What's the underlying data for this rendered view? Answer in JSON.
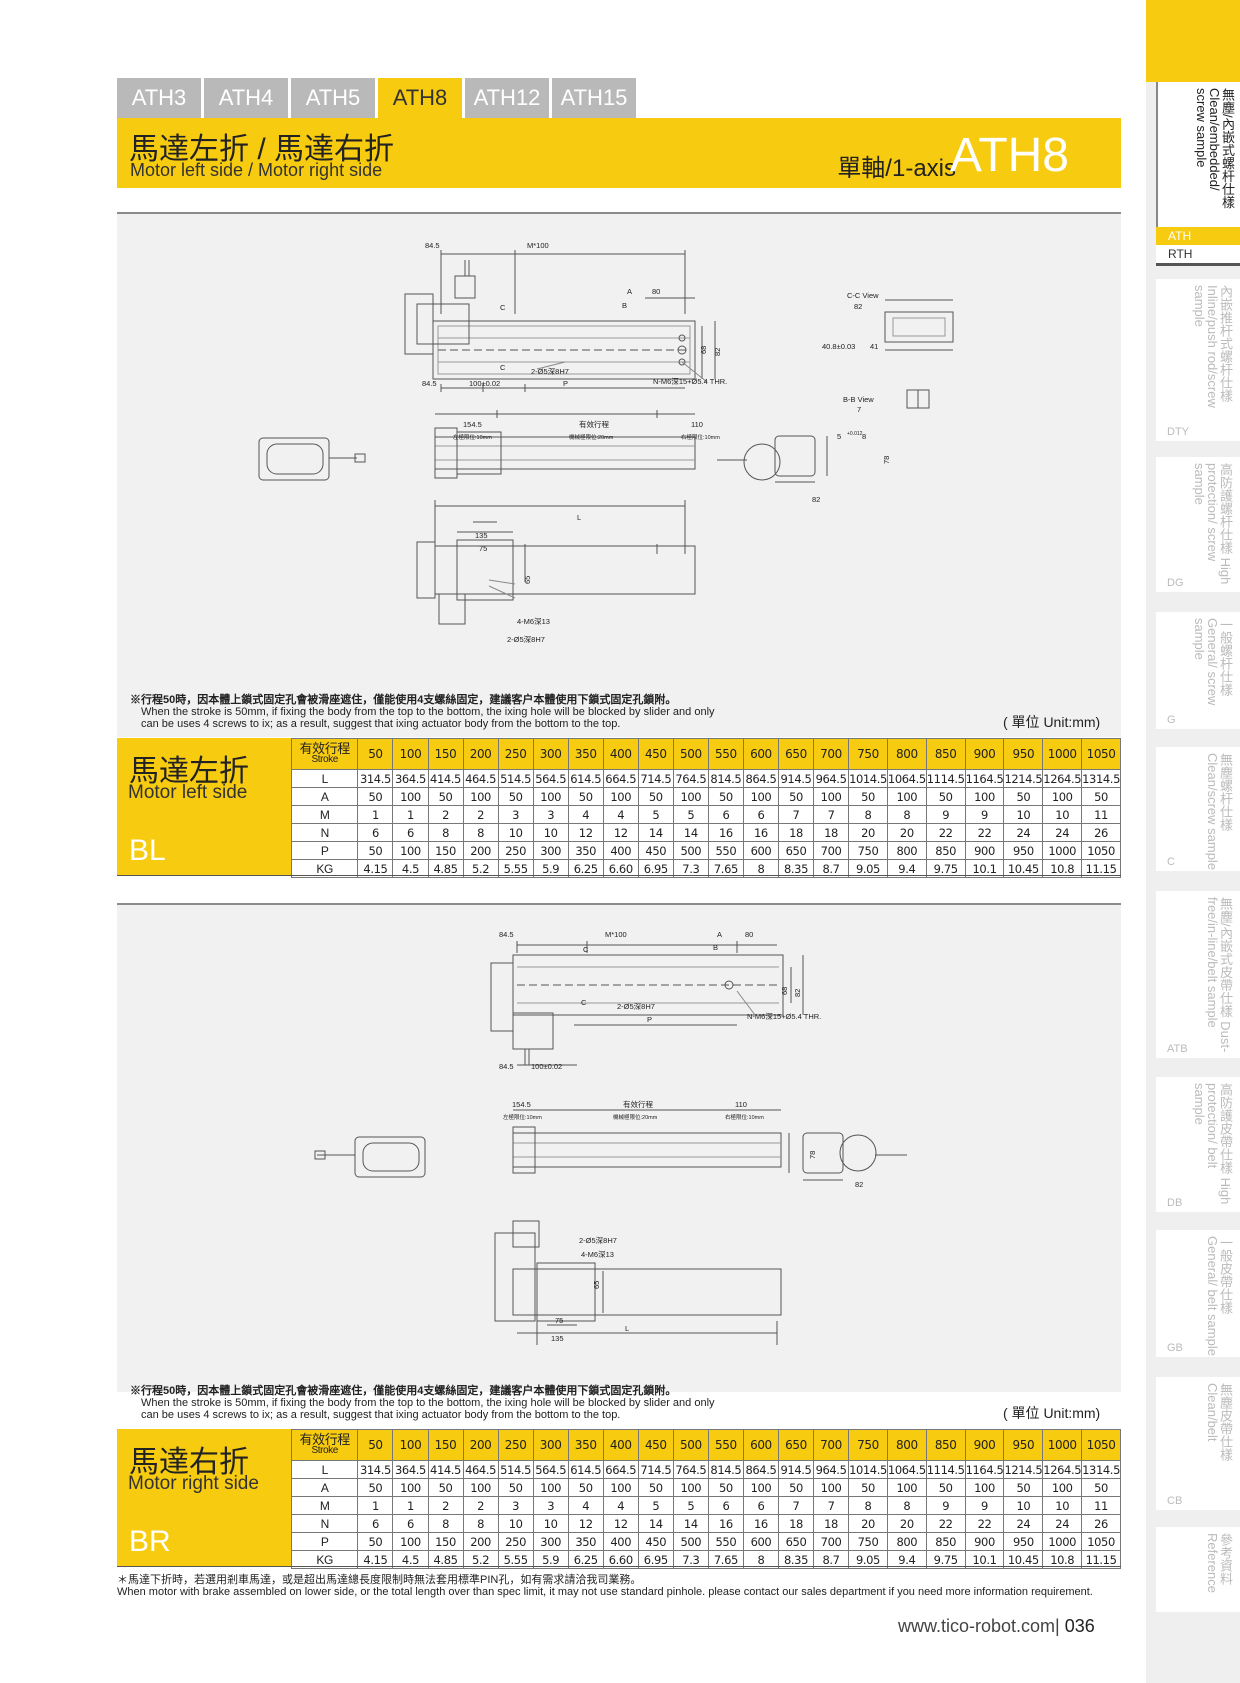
{
  "tabs": [
    "ATH3",
    "ATH4",
    "ATH5",
    "ATH8",
    "ATH12",
    "ATH15"
  ],
  "active_tab": "ATH8",
  "title": {
    "cn": "馬達左折 / 馬達右折",
    "en": "Motor left side / Motor right side",
    "axis": "單軸/1-axis",
    "model": "ATH8"
  },
  "drawing1": {
    "dims": {
      "d84_5": "84.5",
      "m100": "M*100",
      "a": "A",
      "b": "B",
      "c": "C",
      "d80": "80",
      "d68": "68",
      "d82": "82",
      "hole_c": "2-Ø5深8H7",
      "thread": "N-M6深15+Ø5.4 THR.",
      "d100": "100±0.02",
      "p": "P",
      "cc_view": "C-C View",
      "cc_82": "82",
      "cc_408": "40.8±0.03",
      "cc_41": "41",
      "bb_view": "B-B View",
      "bb_7": "7",
      "bb_5": "5",
      "bb_8": "8",
      "bb_tol": "+0.012",
      "d154_5": "154.5",
      "stroke": "有效行程",
      "d110": "110",
      "left_stop": "左極限位:10mm",
      "mid_stop": "機械極限位:20mm",
      "right_stop": "右極限位:10mm",
      "d78": "78",
      "end_82": "82",
      "l": "L",
      "d135": "135",
      "d75": "75",
      "d65": "65",
      "m6": "4-M6深13",
      "h7": "2-Ø5深8H7"
    }
  },
  "drawing2": {
    "dims": {
      "d84_5": "84.5",
      "m100": "M*100",
      "a": "A",
      "b": "B",
      "c": "C",
      "d80": "80",
      "d68": "68",
      "d82": "82",
      "hole_c": "2-Ø5深8H7",
      "thread": "N-M6深15+Ø5.4 THR.",
      "d100": "100±0.02",
      "p": "P",
      "d154_5": "154.5",
      "stroke": "有效行程",
      "d110": "110",
      "left_stop": "左極限位:10mm",
      "mid_stop": "機械極限位:20mm",
      "right_stop": "右極限位:10mm",
      "d78": "78",
      "end_82": "82",
      "l": "L",
      "d135": "135",
      "d75": "75",
      "d65": "65",
      "m6": "4-M6深13",
      "h7": "2-Ø5深8H7"
    }
  },
  "note": {
    "cn": "※行程50時，因本體上鎖式固定孔會被滑座遮住，僅能使用4支螺絲固定，建議客户本體使用下鎖式固定孔鎖附。",
    "en1": "When the stroke is 50mm, if fixing the body from the top to the bottom, the ixing hole will be blocked by slider and only",
    "en2": "can be uses 4 screws to ix; as a result, suggest that ixing actuator body from the bottom to the top.",
    "unit": "( 單位 Unit:mm)"
  },
  "table_header": {
    "cn": "有效行程",
    "en": "Stroke"
  },
  "strokes": [
    "50",
    "100",
    "150",
    "200",
    "250",
    "300",
    "350",
    "400",
    "450",
    "500",
    "550",
    "600",
    "650",
    "700",
    "750",
    "800",
    "850",
    "900",
    "950",
    "1000",
    "1050"
  ],
  "rows": [
    {
      "label": "L",
      "values": [
        "314.5",
        "364.5",
        "414.5",
        "464.5",
        "514.5",
        "564.5",
        "614.5",
        "664.5",
        "714.5",
        "764.5",
        "814.5",
        "864.5",
        "914.5",
        "964.5",
        "1014.5",
        "1064.5",
        "1114.5",
        "1164.5",
        "1214.5",
        "1264.5",
        "1314.5"
      ]
    },
    {
      "label": "A",
      "values": [
        "50",
        "100",
        "50",
        "100",
        "50",
        "100",
        "50",
        "100",
        "50",
        "100",
        "50",
        "100",
        "50",
        "100",
        "50",
        "100",
        "50",
        "100",
        "50",
        "100",
        "50"
      ]
    },
    {
      "label": "M",
      "values": [
        "1",
        "1",
        "2",
        "2",
        "3",
        "3",
        "4",
        "4",
        "5",
        "5",
        "6",
        "6",
        "7",
        "7",
        "8",
        "8",
        "9",
        "9",
        "10",
        "10",
        "11"
      ]
    },
    {
      "label": "N",
      "values": [
        "6",
        "6",
        "8",
        "8",
        "10",
        "10",
        "12",
        "12",
        "14",
        "14",
        "16",
        "16",
        "18",
        "18",
        "20",
        "20",
        "22",
        "22",
        "24",
        "24",
        "26"
      ]
    },
    {
      "label": "P",
      "values": [
        "50",
        "100",
        "150",
        "200",
        "250",
        "300",
        "350",
        "400",
        "450",
        "500",
        "550",
        "600",
        "650",
        "700",
        "750",
        "800",
        "850",
        "900",
        "950",
        "1000",
        "1050"
      ]
    },
    {
      "label": "KG",
      "values": [
        "4.15",
        "4.5",
        "4.85",
        "5.2",
        "5.55",
        "5.9",
        "6.25",
        "6.60",
        "6.95",
        "7.3",
        "7.65",
        "8",
        "8.35",
        "8.7",
        "9.05",
        "9.4",
        "9.75",
        "10.1",
        "10.45",
        "10.8",
        "11.15"
      ]
    }
  ],
  "spec_left": {
    "cn": "馬達左折",
    "en": "Motor left side",
    "code": "BL"
  },
  "spec_right": {
    "cn": "馬達右折",
    "en": "Motor right side",
    "code": "BR"
  },
  "footnote": {
    "cn": "＊馬達下折時，若選用剎車馬達，或是超出馬達總長度限制時無法套用標準PIN孔，如有需求請洽我司業務。",
    "en": "When motor with brake assembled on lower side, or the total length over than spec limit, it may not use standard pinhole. please contact our sales department if you need more information requirement."
  },
  "footer": {
    "url": "www.tico-robot.com",
    "sep": "|",
    "page": "036"
  },
  "sidebar": [
    {
      "text": "無塵/內嵌式螺杆仕樣 Clean/embedded/ screw sample",
      "codes": [
        "ATH",
        "RTH"
      ]
    },
    {
      "text": "內嵌推杆式螺杆仕樣 Inline/push rod/screw sample",
      "codes": [
        "DTY"
      ]
    },
    {
      "text": "高防護螺杆仕樣 High protection/ screw sample",
      "codes": [
        "DG"
      ]
    },
    {
      "text": "一般螺杆仕樣 General/ screw sample",
      "codes": [
        "G"
      ]
    },
    {
      "text": "無塵螺杆仕樣 Clean/screw sample",
      "codes": [
        "C"
      ]
    },
    {
      "text": "無塵/內嵌式皮帶仕樣 Dust-free/in-line/belt sample",
      "codes": [
        "ATB"
      ]
    },
    {
      "text": "高防護皮帶仕樣 High protection/ belt sample",
      "codes": [
        "DB"
      ]
    },
    {
      "text": "一般皮帶仕樣 General/ belt sample",
      "codes": [
        "GB"
      ]
    },
    {
      "text": "無塵皮帶仕樣 Clean/belt",
      "codes": [
        "CB"
      ]
    },
    {
      "text": "參考資料 Reference",
      "codes": []
    }
  ]
}
